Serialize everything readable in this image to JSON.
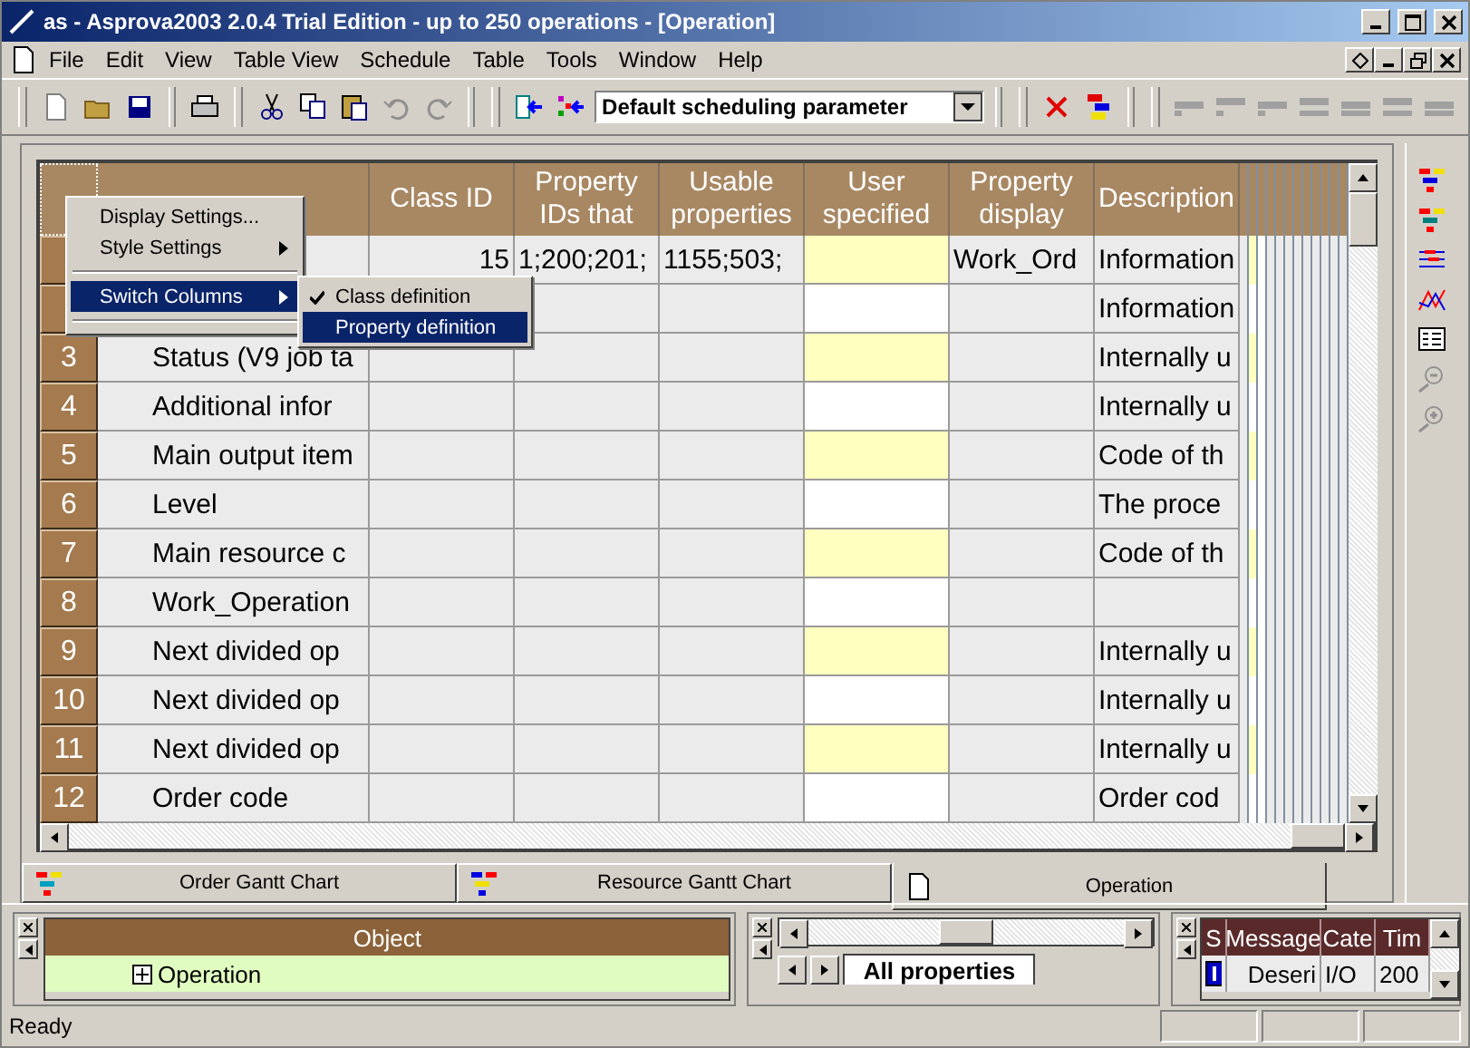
{
  "window": {
    "title": "as - Asprova2003 2.0.4 Trial Edition  - up to 250 operations - [Operation]"
  },
  "menu": [
    "File",
    "Edit",
    "View",
    "Table View",
    "Schedule",
    "Table",
    "Tools",
    "Window",
    "Help"
  ],
  "toolbar": {
    "scheduling_parameter": "Default scheduling parameter"
  },
  "table": {
    "columns": [
      {},
      {
        "label": "Class ID"
      },
      {
        "label": "Property IDs that"
      },
      {
        "label": "Usable properties"
      },
      {
        "label": "User specified"
      },
      {
        "label": "Property display"
      },
      {
        "label": "Description"
      }
    ],
    "rows": [
      {
        "class_id": "15",
        "property_ids": "1;200;201;",
        "usable": "1155;503;",
        "display": "Work_Ord",
        "description": "Information"
      },
      {
        "description": "Information"
      },
      {
        "number": "3",
        "code": "Status (V9 job ta",
        "description": "Internally u"
      },
      {
        "number": "4",
        "code": "Additional infor",
        "description": "Internally u"
      },
      {
        "number": "5",
        "code": "Main output item",
        "description": "Code of th"
      },
      {
        "number": "6",
        "code": "Level",
        "description": "The proce"
      },
      {
        "number": "7",
        "code": "Main resource c",
        "description": "Code of th"
      },
      {
        "number": "8",
        "code": "Work_Operation"
      },
      {
        "number": "9",
        "code": "Next divided op",
        "description": "Internally u"
      },
      {
        "number": "10",
        "code": "Next divided op",
        "description": "Internally u"
      },
      {
        "number": "11",
        "code": "Next divided op",
        "description": "Internally u"
      },
      {
        "number": "12",
        "code": "Order code",
        "description": "Order cod"
      }
    ]
  },
  "context_menu": {
    "items": [
      {
        "kind": "item",
        "label": "Display Settings...",
        "selected": false
      },
      {
        "kind": "submenu",
        "label": "Style Settings",
        "selected": false
      },
      {
        "kind": "separator"
      },
      {
        "kind": "submenu",
        "label": "Switch Columns",
        "selected": true
      },
      {
        "kind": "separator"
      }
    ],
    "submenu": [
      {
        "label": "Class definition",
        "checked": true,
        "selected": false
      },
      {
        "label": "Property definition",
        "checked": false,
        "selected": true
      }
    ]
  },
  "doc_tabs": [
    {
      "label": "Order Gantt Chart",
      "selected": false,
      "kind": "order"
    },
    {
      "label": "Resource Gantt Chart",
      "selected": false,
      "kind": "resource"
    },
    {
      "label": "Operation",
      "selected": true,
      "kind": "table"
    }
  ],
  "object_pane": {
    "header": "Object",
    "items": [
      {
        "label": "Operation",
        "expanded": false
      }
    ]
  },
  "property_pane": {
    "tab": "All properties"
  },
  "message_pane": {
    "columns": [
      "S",
      "Message",
      "Cate",
      "Tim"
    ],
    "rows": [
      {
        "message": "Deseri",
        "category": "I/O",
        "time": "200"
      }
    ]
  },
  "status_bar": {
    "text": "Ready"
  }
}
